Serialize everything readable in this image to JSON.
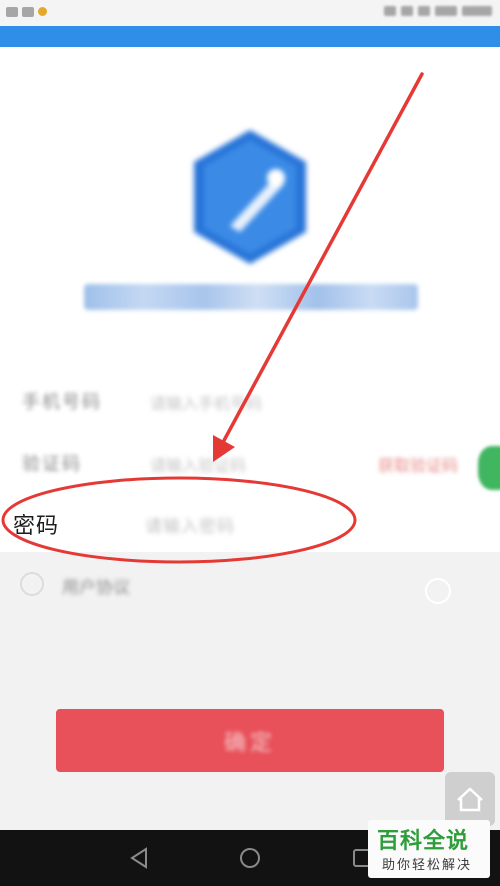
{
  "status_bar": {
    "left_icons": [
      "sim-icon",
      "notification-icon",
      "weather-icon"
    ],
    "right_icons": [
      "alarm-icon",
      "wifi-icon",
      "signal-icon",
      "battery-icon",
      "clock"
    ]
  },
  "header": {
    "accent_color": "#2f8fe8"
  },
  "app": {
    "logo_icon": "app-logo-icon",
    "name": "██████ ██████ ████"
  },
  "form": {
    "phone": {
      "label": "手机号码",
      "placeholder": "请输入手机号码"
    },
    "code": {
      "label": "验证码",
      "placeholder": "请输入验证码",
      "button": "获取验证码"
    },
    "password": {
      "label": "密码",
      "placeholder": "请输入密码"
    },
    "agreement": {
      "text": "用户协议"
    },
    "confirm_label": "确定"
  },
  "annotation": {
    "color": "#e53935"
  },
  "nav_bar": {
    "icons": [
      "back-icon",
      "home-icon",
      "recents-icon"
    ]
  },
  "watermark": {
    "title": "百科全说",
    "subtitle": "助你轻松解决"
  }
}
